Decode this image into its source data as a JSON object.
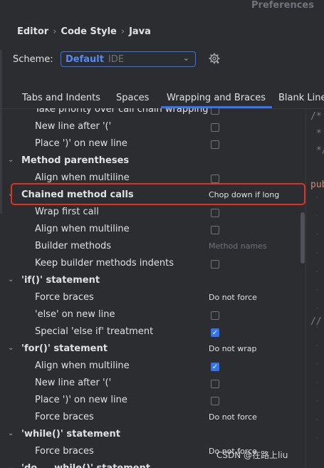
{
  "window": {
    "title": "Preferences"
  },
  "breadcrumb": [
    "Editor",
    "Code Style",
    "Java"
  ],
  "scheme": {
    "label": "Scheme:",
    "value": "Default",
    "sub": "IDE"
  },
  "tabs": [
    {
      "label": "Tabs and Indents",
      "active": false
    },
    {
      "label": "Spaces",
      "active": false
    },
    {
      "label": "Wrapping and Braces",
      "active": true
    },
    {
      "label": "Blank Lines",
      "active": false
    }
  ],
  "options": [
    {
      "label": "Take priority over call chain wrapping",
      "level": 1,
      "control": "checkbox",
      "checked": false
    },
    {
      "label": "New line after '('",
      "level": 1,
      "control": "checkbox",
      "checked": false
    },
    {
      "label": "Place ')' on new line",
      "level": 1,
      "control": "checkbox",
      "checked": false
    },
    {
      "label": "Method parentheses",
      "level": 0,
      "group": true,
      "control": "none"
    },
    {
      "label": "Align when multiline",
      "level": 1,
      "control": "checkbox",
      "checked": false
    },
    {
      "label": "Chained method calls",
      "level": 0,
      "group": true,
      "control": "value",
      "value": "Chop down if long"
    },
    {
      "label": "Wrap first call",
      "level": 1,
      "control": "checkbox",
      "checked": false
    },
    {
      "label": "Align when multiline",
      "level": 1,
      "control": "checkbox",
      "checked": false
    },
    {
      "label": "Builder methods",
      "level": 1,
      "control": "placeholder",
      "value": "Method names"
    },
    {
      "label": "Keep builder methods indents",
      "level": 1,
      "control": "checkbox",
      "checked": false
    },
    {
      "label": "'if()' statement",
      "level": 0,
      "group": true,
      "control": "none"
    },
    {
      "label": "Force braces",
      "level": 1,
      "control": "value",
      "value": "Do not force"
    },
    {
      "label": "'else' on new line",
      "level": 1,
      "control": "checkbox",
      "checked": false
    },
    {
      "label": "Special 'else if' treatment",
      "level": 1,
      "control": "checkbox",
      "checked": true
    },
    {
      "label": "'for()' statement",
      "level": 0,
      "group": true,
      "control": "value",
      "value": "Do not wrap"
    },
    {
      "label": "Align when multiline",
      "level": 1,
      "control": "checkbox",
      "checked": true
    },
    {
      "label": "New line after '('",
      "level": 1,
      "control": "checkbox",
      "checked": false
    },
    {
      "label": "Place ')' on new line",
      "level": 1,
      "control": "checkbox",
      "checked": false
    },
    {
      "label": "Force braces",
      "level": 1,
      "control": "value",
      "value": "Do not force"
    },
    {
      "label": "'while()' statement",
      "level": 0,
      "group": true,
      "control": "none"
    },
    {
      "label": "Force braces",
      "level": 1,
      "control": "value",
      "value": "Do not force"
    },
    {
      "label": "'do ... while()' statement",
      "level": 0,
      "group": true,
      "control": "none"
    }
  ],
  "code_preview": [
    {
      "text": "/*",
      "kind": "comment"
    },
    {
      "text": " *",
      "kind": "comment"
    },
    {
      "text": " */",
      "kind": "comment"
    },
    {
      "text": "",
      "kind": "blank"
    },
    {
      "text": "pub",
      "kind": "keyword"
    },
    {
      "text": "",
      "kind": "blank"
    },
    {
      "text": "",
      "kind": "blank"
    },
    {
      "text": "",
      "kind": "blank"
    },
    {
      "text": "",
      "kind": "blank"
    },
    {
      "text": "",
      "kind": "blank"
    },
    {
      "text": "",
      "kind": "blank"
    },
    {
      "text": "",
      "kind": "blank"
    },
    {
      "text": "//",
      "kind": "comment"
    }
  ],
  "watermark": "CSDN @在路上liu",
  "colors": {
    "accent": "#3574f0",
    "highlight": "#e0311f",
    "background": "#2b2d30"
  }
}
